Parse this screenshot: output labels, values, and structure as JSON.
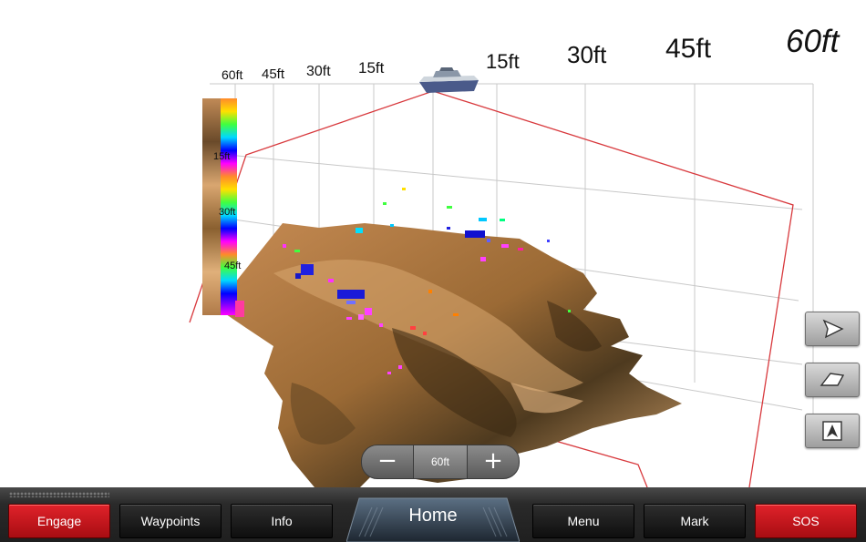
{
  "depth_scale_left": {
    "labels": [
      "60ft",
      "45ft",
      "30ft",
      "15ft"
    ]
  },
  "depth_scale_right": {
    "labels": [
      "15ft",
      "30ft",
      "45ft",
      "60ft"
    ]
  },
  "color_bar": {
    "labels": [
      "15ft",
      "30ft",
      "45ft"
    ]
  },
  "zoom": {
    "minus": "−",
    "level": "60ft",
    "plus": "+"
  },
  "view_controls": [
    {
      "name": "perspective-view-1",
      "icon": "boat-angle-icon"
    },
    {
      "name": "perspective-view-2",
      "icon": "boat-side-icon"
    },
    {
      "name": "overhead-view",
      "icon": "north-arrow-icon"
    }
  ],
  "bottom_bar": {
    "engage": "Engage",
    "waypoints": "Waypoints",
    "info": "Info",
    "home": "Home",
    "menu": "Menu",
    "mark": "Mark",
    "sos": "SOS"
  },
  "colors": {
    "red_button": "#d0161d",
    "dark_button": "#1a1a1a",
    "bottom_bar": "#2b2b2b",
    "seafloor_light": "#d6a06a",
    "seafloor_dark": "#5a3d1e",
    "boundary_line": "#d8393d"
  }
}
